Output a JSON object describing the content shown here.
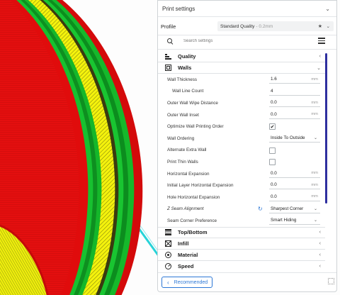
{
  "panel": {
    "title": "Print settings",
    "collapse_icon": "chevron-down-icon"
  },
  "profile": {
    "label": "Profile",
    "name": "Standard Quality",
    "detail": "- 0.2mm",
    "favorite_icon": "star-icon"
  },
  "search": {
    "placeholder": "Search settings"
  },
  "categories": {
    "quality": "Quality",
    "walls": "Walls",
    "top_bottom": "Top/Bottom",
    "infill": "Infill",
    "material": "Material",
    "speed": "Speed"
  },
  "walls": {
    "wall_thickness": {
      "label": "Wall Thickness",
      "value": "1.6",
      "unit": "mm"
    },
    "wall_line_count": {
      "label": "Wall Line Count",
      "value": "4"
    },
    "outer_wall_wipe_distance": {
      "label": "Outer Wall Wipe Distance",
      "value": "0.0",
      "unit": "mm"
    },
    "outer_wall_inset": {
      "label": "Outer Wall Inset",
      "value": "0.0",
      "unit": "mm"
    },
    "optimize_wall_printing_order": {
      "label": "Optimize Wall Printing Order",
      "checked": true,
      "mark": "✔"
    },
    "wall_ordering": {
      "label": "Wall Ordering",
      "value": "Inside To Outside"
    },
    "alternate_extra_wall": {
      "label": "Alternate Extra Wall",
      "checked": false
    },
    "print_thin_walls": {
      "label": "Print Thin Walls",
      "checked": false
    },
    "horizontal_expansion": {
      "label": "Horizontal Expansion",
      "value": "0.0",
      "unit": "mm"
    },
    "initial_layer_horizontal_expansion": {
      "label": "Initial Layer Horizontal Expansion",
      "value": "0.0",
      "unit": "mm"
    },
    "hole_horizontal_expansion": {
      "label": "Hole Horizontal Expansion",
      "value": "0.0",
      "unit": "mm"
    },
    "z_seam_alignment": {
      "label": "Z Seam Alignment",
      "value": "Sharpest Corner"
    },
    "seam_corner_preference": {
      "label": "Seam Corner Preference",
      "value": "Smart Hiding"
    }
  },
  "footer": {
    "recommended_label": "Recommended"
  },
  "colors": {
    "accent": "#2b77d6",
    "scrollbar": "#2e2f9f",
    "layer_red": "#e30d0d",
    "layer_green": "#11c02a",
    "layer_yellow": "#f2f20a",
    "travel_cyan": "#27d3d8"
  }
}
